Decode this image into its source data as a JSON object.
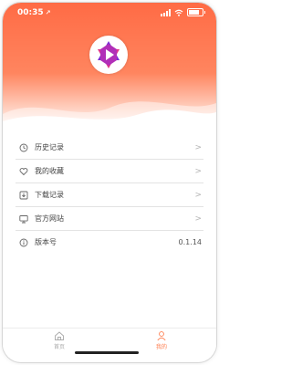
{
  "status_bar": {
    "time": "00:35",
    "location_glyph": "↗"
  },
  "colors": {
    "accent": "#ff7a4a",
    "hero_top": "#ff6b45"
  },
  "app": {
    "logo_icon": "play-hexagram-logo"
  },
  "menu": {
    "items": [
      {
        "label": "历史记录",
        "icon": "clock-icon"
      },
      {
        "label": "我的收藏",
        "icon": "heart-icon"
      },
      {
        "label": "下载记录",
        "icon": "download-icon"
      },
      {
        "label": "官方网站",
        "icon": "monitor-icon"
      }
    ],
    "version": {
      "label": "版本号",
      "value": "0.1.14",
      "icon": "info-icon"
    },
    "chevron": ">"
  },
  "tabbar": {
    "tabs": [
      {
        "label": "首页",
        "icon": "home-icon"
      },
      {
        "label": "我的",
        "icon": "user-icon"
      }
    ]
  }
}
